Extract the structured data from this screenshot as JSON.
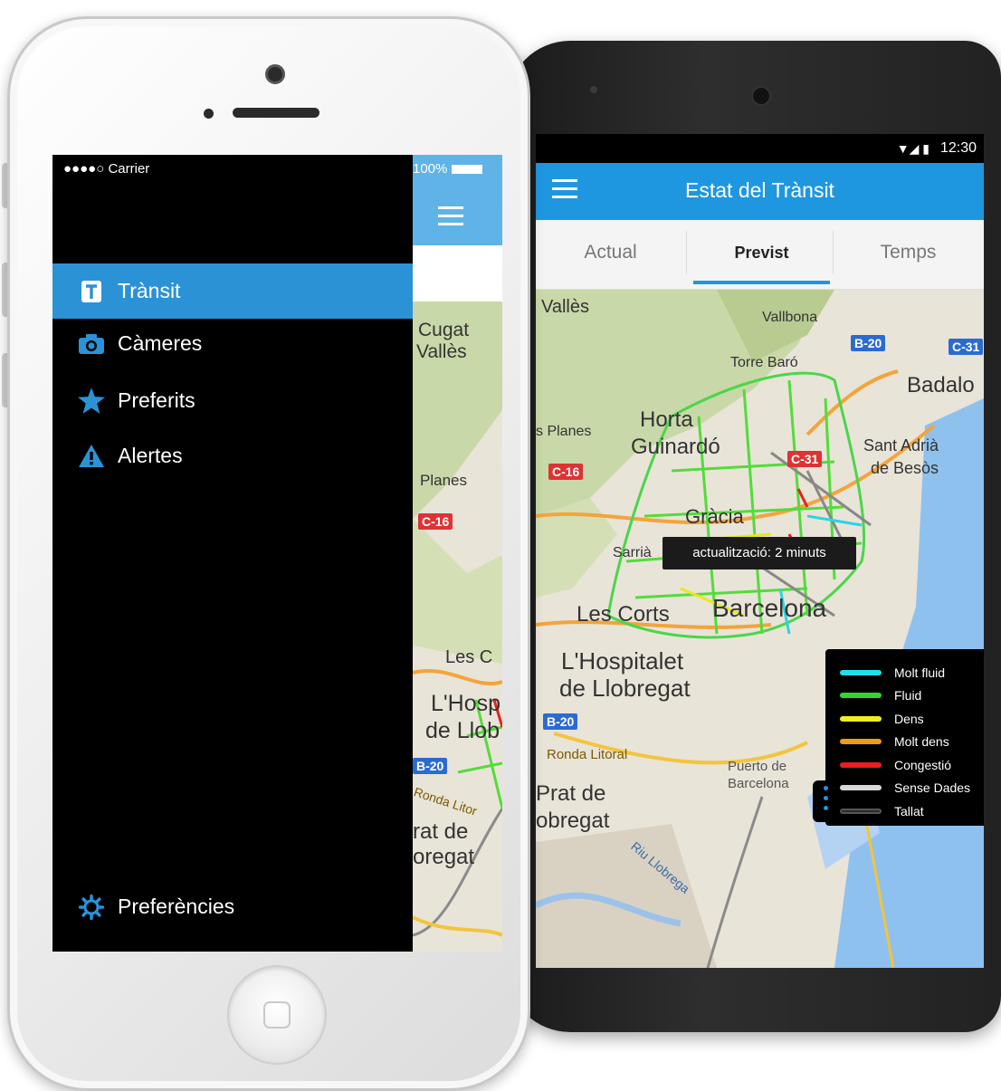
{
  "android": {
    "status": {
      "time": "12:30"
    },
    "appbar": {
      "title": "Estat del Trànsit",
      "menu_icon": "hamburger-icon"
    },
    "tabs": [
      {
        "label": "Actual",
        "active": false
      },
      {
        "label": "Previst",
        "active": true
      },
      {
        "label": "Temps",
        "active": false
      }
    ],
    "tooltip": "actualització: 2 minuts",
    "map_labels": {
      "valles": "Vallès",
      "vallbona": "Vallbona",
      "torre_baro": "Torre Baró",
      "badalona": "Badalo",
      "planes": "s Planes",
      "horta": "Horta",
      "guinardo": "Guinardó",
      "sant_adria": "Sant Adrià",
      "de_besos": "de Besòs",
      "gracia": "Gràcia",
      "sarria": "Sarrià",
      "les_corts": "Les Corts",
      "barcelona": "Barcelona",
      "hospitalet1": "L'Hospitalet",
      "hospitalet2": "de Llobregat",
      "ronda": "Ronda Litoral",
      "puerto1": "Puerto de",
      "puerto2": "Barcelona",
      "prat1": "Prat de",
      "prat2": "obregat",
      "riu": "Riu Llobrega",
      "b20a": "B-20",
      "c31a": "C-31",
      "c16": "C-16",
      "c31b": "C-31",
      "b20b": "B-20"
    },
    "legend": [
      {
        "label": "Molt fluid",
        "color": "#1ee0e8"
      },
      {
        "label": "Fluid",
        "color": "#2fd82f"
      },
      {
        "label": "Dens",
        "color": "#f2ec1c"
      },
      {
        "label": "Molt dens",
        "color": "#f29a14"
      },
      {
        "label": "Congestió",
        "color": "#e6201c"
      },
      {
        "label": "Sense Dades",
        "color": "#d8d8d8"
      },
      {
        "label": "Tallat",
        "color": "#2a2a2a"
      }
    ]
  },
  "iphone": {
    "status": {
      "carrier": "●●●●○ Carrier",
      "battery": "100%"
    },
    "drawer": {
      "items": [
        {
          "label": "Trànsit",
          "icon": "traffic-icon",
          "active": true
        },
        {
          "label": "Càmeres",
          "icon": "camera-icon",
          "active": false
        },
        {
          "label": "Preferits",
          "icon": "star-icon",
          "active": false
        },
        {
          "label": "Alertes",
          "icon": "warning-icon",
          "active": false
        }
      ],
      "footer": {
        "label": "Preferències",
        "icon": "gear-icon"
      }
    },
    "peek_labels": {
      "cugat1": "Cugat",
      "cugat2": "Vallès",
      "planes": "Planes",
      "c16": "C-16",
      "lesc": "Les C",
      "hosp1": "L'Hosp",
      "hosp2": "de Llob",
      "b20": "B-20",
      "ronda": "Ronda Litor",
      "prat1": "rat de",
      "prat2": "oregat"
    }
  },
  "colors": {
    "accent": "#1f97e0",
    "drawer_active": "#2b92d6"
  }
}
